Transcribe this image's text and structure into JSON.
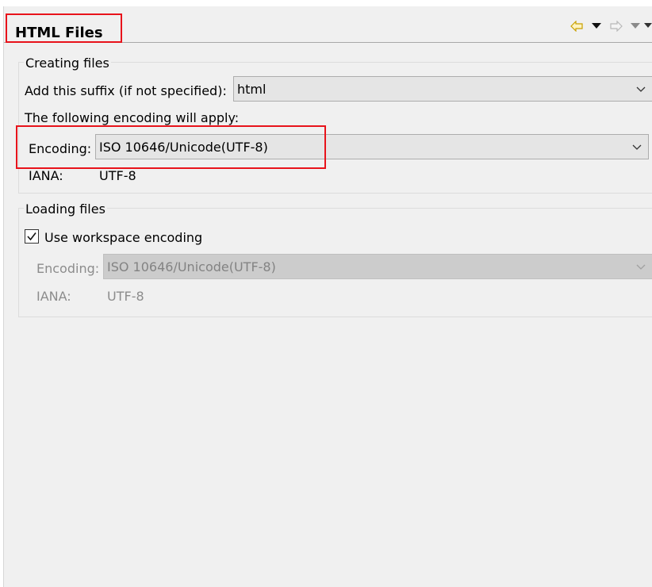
{
  "page": {
    "title": "HTML Files"
  },
  "toolbar": {
    "back_icon": "back-arrow-icon",
    "back_menu_icon": "dropdown-triangle-icon",
    "forward_icon": "forward-arrow-icon",
    "forward_menu_icon": "dropdown-triangle-icon",
    "back_color": "#c8a000",
    "forward_color": "#b8b8b8"
  },
  "creating": {
    "legend": "Creating files",
    "suffix_label": "Add this suffix (if not specified):",
    "suffix_value": "html",
    "encoding_note": "The following encoding will apply:",
    "encoding_label": "Encoding:",
    "encoding_value": "ISO 10646/Unicode(UTF-8)",
    "iana_label": "IANA:",
    "iana_value": "UTF-8"
  },
  "loading": {
    "legend": "Loading files",
    "workspace_label": "Use workspace encoding",
    "workspace_checked": true,
    "encoding_label": "Encoding:",
    "encoding_value": "ISO 10646/Unicode(UTF-8)",
    "iana_label": "IANA:",
    "iana_value": "UTF-8"
  },
  "colors": {
    "highlight": "#e8131b",
    "panel_bg": "#f0f0f0"
  }
}
